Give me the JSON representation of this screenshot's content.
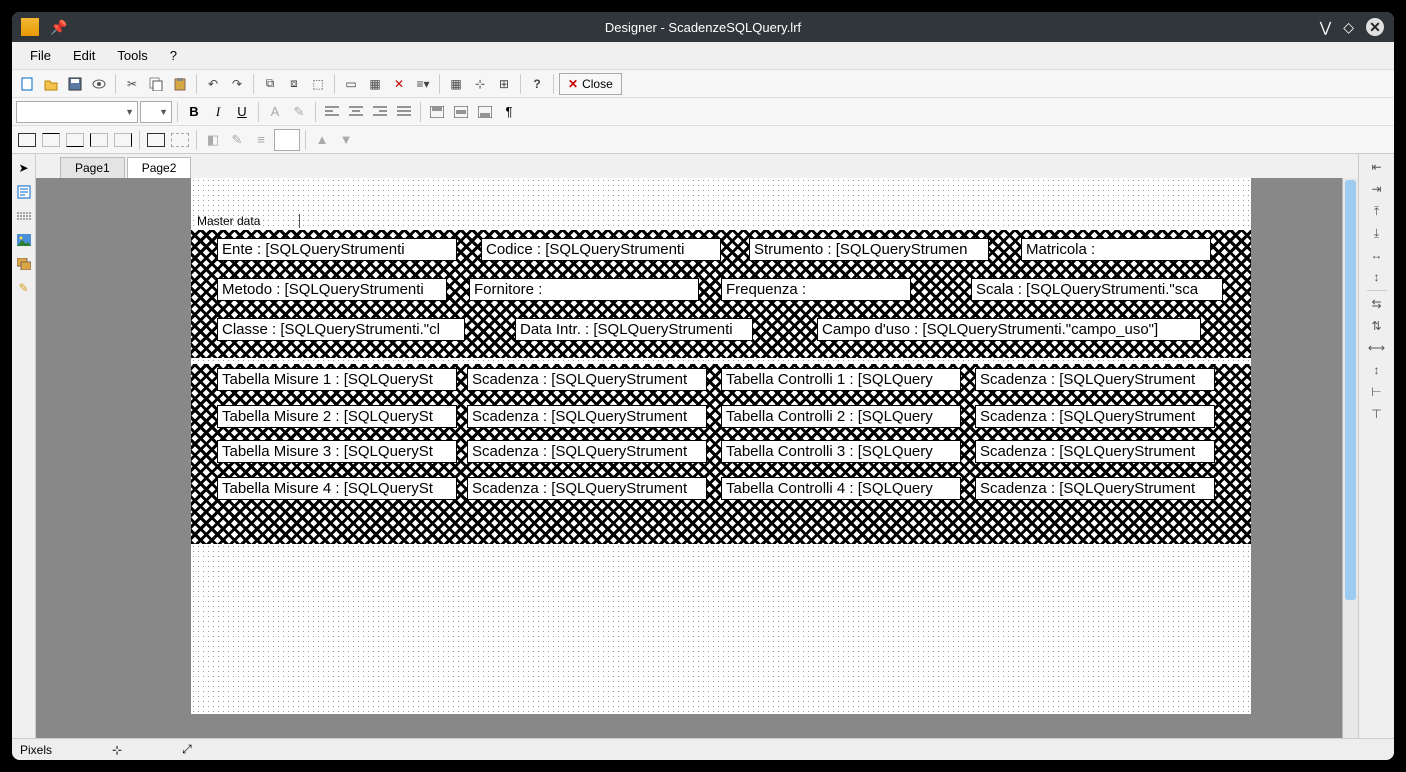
{
  "window": {
    "title": "Designer - ScadenzeSQLQuery.lrf"
  },
  "menu": {
    "file": "File",
    "edit": "Edit",
    "tools": "Tools",
    "help": "?"
  },
  "toolbar": {
    "close": "Close"
  },
  "tabs": {
    "page1": "Page1",
    "page2": "Page2"
  },
  "band": {
    "master_label": "Master data"
  },
  "fields": {
    "r1": {
      "ente": "Ente :  [SQLQueryStrumenti",
      "codice": "Codice : [SQLQueryStrumenti",
      "strumento": "Strumento : [SQLQueryStrumen",
      "matricola": "Matricola :"
    },
    "r2": {
      "metodo": "Metodo : [SQLQueryStrumenti",
      "fornitore": "Fornitore :",
      "frequenza": "Frequenza :",
      "scala": "Scala : [SQLQueryStrumenti.\"sca"
    },
    "r3": {
      "classe": "Classe : [SQLQueryStrumenti.\"cl",
      "data_intr": "Data Intr. : [SQLQueryStrumenti",
      "campo_uso": "Campo d'uso :  [SQLQueryStrumenti.\"campo_uso\"]"
    },
    "tab": {
      "m1": "Tabella Misure 1 :  [SQLQuerySt",
      "s_m1": "Scadenza : [SQLQueryStrument",
      "c1": "Tabella Controlli 1 :  [SQLQuery",
      "s_c1": "Scadenza : [SQLQueryStrument",
      "m2": "Tabella Misure 2 :  [SQLQuerySt",
      "s_m2": "Scadenza : [SQLQueryStrument",
      "c2": "Tabella Controlli 2 :  [SQLQuery",
      "s_c2": "Scadenza : [SQLQueryStrument",
      "m3": "Tabella Misure 3 :  [SQLQuerySt",
      "s_m3": "Scadenza : [SQLQueryStrument",
      "c3": "Tabella Controlli 3 :  [SQLQuery",
      "s_c3": "Scadenza : [SQLQueryStrument",
      "m4": "Tabella Misure 4 :  [SQLQuerySt",
      "s_m4": "Scadenza : [SQLQueryStrument",
      "c4": "Tabella Controlli 4 :  [SQLQuery",
      "s_c4": "Scadenza : [SQLQueryStrument"
    }
  },
  "status": {
    "units": "Pixels"
  }
}
